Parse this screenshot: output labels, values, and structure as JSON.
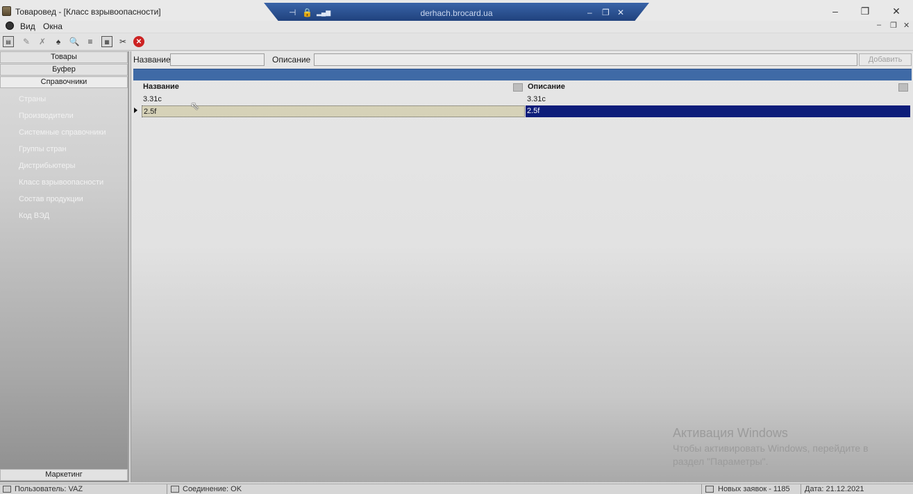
{
  "window": {
    "title": "Товаровед - [Класс взрывоопасности]",
    "minimize_glyph": "–",
    "restore_glyph": "❐",
    "close_glyph": "✕"
  },
  "rdp": {
    "host": "derhach.brocard.ua",
    "pin_glyph": "⊣",
    "lock_glyph": "🔒",
    "signal_glyph": "▂▄▆",
    "minimize_glyph": "–",
    "restore_glyph": "❐",
    "close_glyph": "✕"
  },
  "menu": {
    "items": [
      "Вид",
      "Окна"
    ],
    "mdi_minimize": "–",
    "mdi_restore": "❐",
    "mdi_close": "✕"
  },
  "toolbar": {
    "icons": [
      "new-document-icon",
      "edit-icon",
      "delete-icon",
      "binoculars-icon",
      "preview-icon",
      "checklist-icon",
      "calculator-icon",
      "settings-icon",
      "stop-icon"
    ],
    "glyphs": [
      "▤",
      "✎",
      "✗",
      "♠",
      "🔍",
      "≡",
      "▦",
      "✂",
      "✕"
    ]
  },
  "sidebar": {
    "panels": [
      {
        "label": "Товары",
        "active": false
      },
      {
        "label": "Буфер",
        "active": false
      },
      {
        "label": "Справочники",
        "active": true
      }
    ],
    "items": [
      {
        "label": "Страны"
      },
      {
        "label": "Производители"
      },
      {
        "label": "Системные справочники"
      },
      {
        "label": "Группы стран"
      },
      {
        "label": "Дистрибьютеры"
      },
      {
        "label": "Класс взрывоопасности"
      },
      {
        "label": "Состав продукции"
      },
      {
        "label": "Код ВЭД"
      }
    ],
    "bottom_panel": "Маркетинг"
  },
  "filter": {
    "name_label": "Название",
    "name_value": "",
    "desc_label": "Описание",
    "desc_value": "",
    "add_button": "Добавить"
  },
  "grid": {
    "columns": [
      "Название",
      "Описание"
    ],
    "rows": [
      {
        "name": "3.31c",
        "description": "3.31c",
        "selected": false
      },
      {
        "name": "2.5f",
        "description": "2.5f",
        "selected": true
      }
    ],
    "cursor_glyph": "⇖"
  },
  "watermark": {
    "title": "Активация Windows",
    "line1": "Чтобы активировать Windows, перейдите в",
    "line2": "раздел \"Параметры\"."
  },
  "status": {
    "user": "Пользователь: VAZ",
    "connection": "Соединение: OK",
    "new_orders": "Новых заявок - 1185",
    "date": "Дата: 21.12.2021"
  },
  "colors": {
    "accent_band": "#3f6aa6",
    "selection": "#0d1d7a",
    "row_highlight": "#d6d2b8",
    "rdp_bar": "#1e3f7a"
  }
}
